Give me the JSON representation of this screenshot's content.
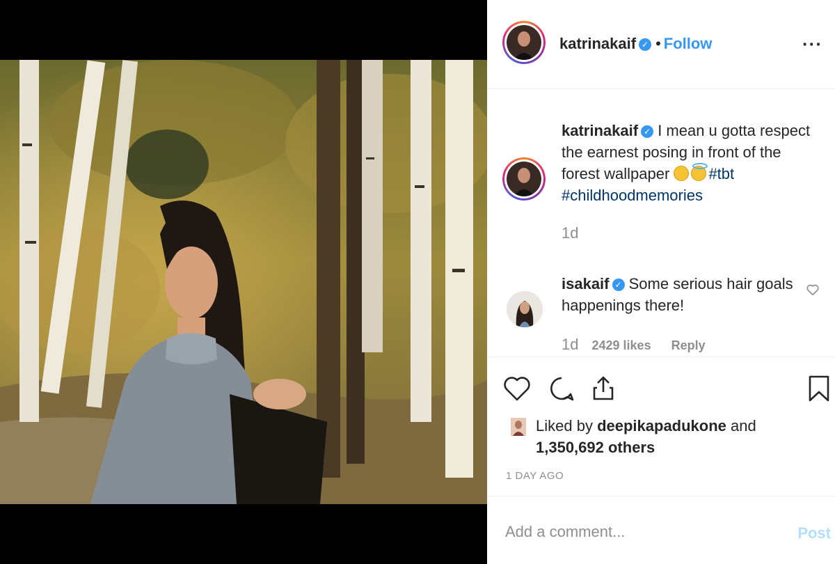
{
  "post": {
    "username": "katrinakaif",
    "verified_mark": "✓",
    "dot": "•",
    "follow_label": "Follow",
    "more_label": "···"
  },
  "caption": {
    "username": "katrinakaif",
    "text": "I mean u gotta respect the earnest posing in front of the forest wallpaper",
    "hashtags": [
      "#tbt",
      "#childhoodmemories"
    ],
    "time": "1d"
  },
  "reply": {
    "username": "isakaif",
    "text": "Some serious hair goals happenings there!",
    "time": "1d",
    "likes": "2429 likes",
    "reply_label": "Reply"
  },
  "likes": {
    "prefix": "Liked by",
    "user": "deepikapadukone",
    "joiner": "and",
    "count": "1,350,692 others"
  },
  "date": "1 DAY AGO",
  "comment": {
    "placeholder": "Add a comment...",
    "post_label": "Post"
  },
  "colors": {
    "accent": "#3897f0",
    "hashtag": "#003569",
    "muted": "#8e8e8e",
    "post_disabled": "#b2dffc"
  }
}
